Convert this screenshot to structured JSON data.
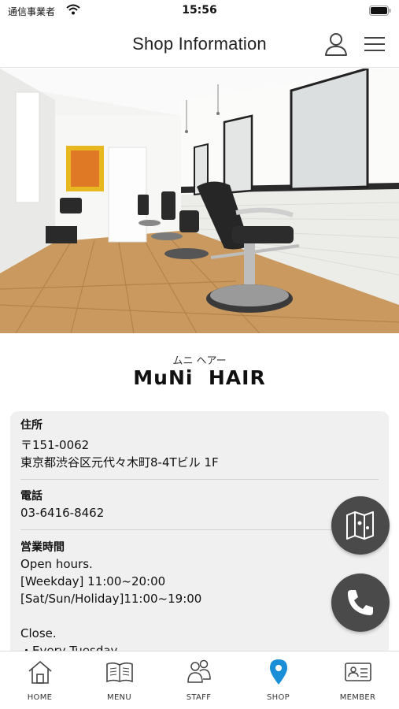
{
  "status_bar": {
    "carrier": "通信事業者",
    "time": "15:56"
  },
  "header": {
    "title": "Shop Information"
  },
  "shop": {
    "name_kana": "ムニ ヘアー",
    "name": "MuNi  HAIR"
  },
  "info": {
    "address_label": "住所",
    "postal_code": "〒151-0062",
    "address": "東京都渋谷区元代々木町8-4Tビル 1F",
    "phone_label": "電話",
    "phone": "03-6416-8462",
    "hours_label": "営業時間",
    "hours_intro": "Open hours.",
    "hours_weekday": "[Weekday] 11:00~20:00",
    "hours_weekend": "[Sat/Sun/Holiday]11:00~19:00",
    "close_label": "Close.",
    "close_day": "・Every Tuesday"
  },
  "tabs": [
    {
      "label": "HOME",
      "icon": "home-icon"
    },
    {
      "label": "MENU",
      "icon": "book-icon"
    },
    {
      "label": "STAFF",
      "icon": "people-icon"
    },
    {
      "label": "SHOP",
      "icon": "location-pin-icon"
    },
    {
      "label": "MEMBER",
      "icon": "id-card-icon"
    }
  ],
  "colors": {
    "accent": "#1a8fd8",
    "fab": "#4a4a4a",
    "card_bg": "#f0f0f0"
  }
}
